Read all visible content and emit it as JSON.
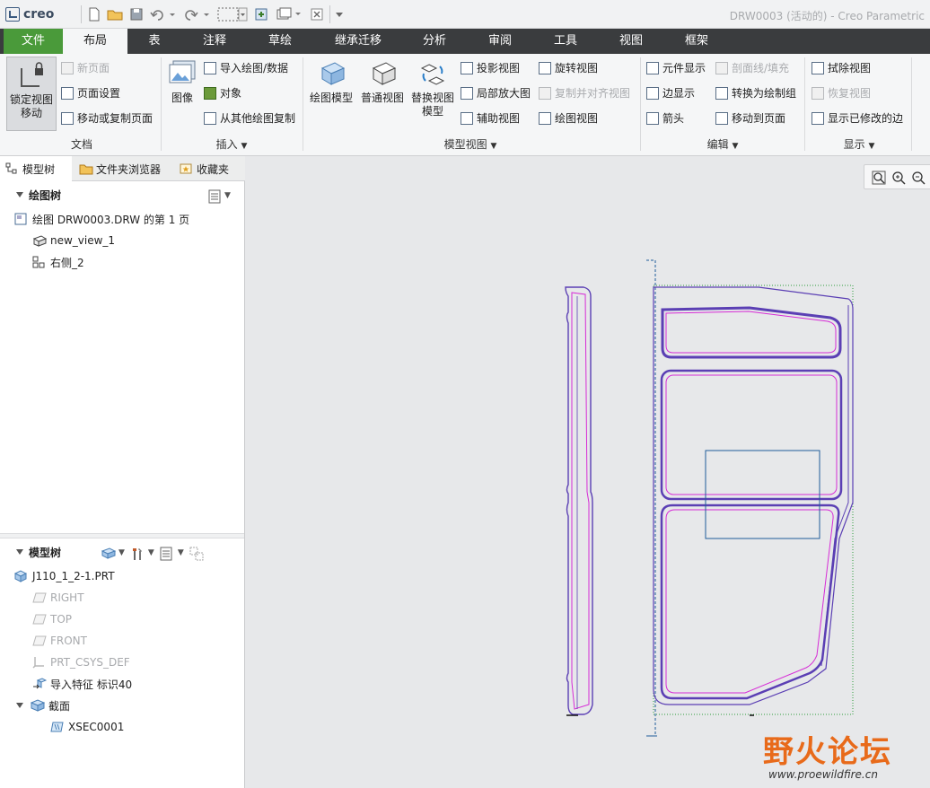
{
  "app": {
    "logo": "creo",
    "window_title": "DRW0003 (活动的) - Creo Parametric"
  },
  "menu_tabs": [
    "文件",
    "布局",
    "表",
    "注释",
    "草绘",
    "继承迁移",
    "分析",
    "审阅",
    "工具",
    "视图",
    "框架"
  ],
  "active_tab": "布局",
  "ribbon": {
    "doc_group": {
      "label": "文档",
      "lock_view_line1": "锁定视图",
      "lock_view_line2": "移动",
      "new_page": "新页面",
      "page_setup": "页面设置",
      "move_copy_page": "移动或复制页面"
    },
    "insert_group": {
      "label": "插入",
      "image": "图像",
      "import_drawing": "导入绘图/数据",
      "object": "对象",
      "copy_from_other": "从其他绘图复制"
    },
    "model_views_group": {
      "label": "模型视图",
      "drawing_model": "绘图模型",
      "general_view": "普通视图",
      "replace_view_line1": "替换视图",
      "replace_view_line2": "模型",
      "projection_view": "投影视图",
      "detailed_view": "局部放大图",
      "auxiliary_view": "辅助视图",
      "revolved_view": "旋转视图",
      "copy_align_view": "复制并对齐视图",
      "drawing_view": "绘图视图"
    },
    "edit_group": {
      "label": "编辑",
      "component_display": "元件显示",
      "section_fill": "剖面线/填充",
      "edge_display": "边显示",
      "convert_to_group": "转换为绘制组",
      "arrows": "箭头",
      "move_to_page": "移动到页面"
    },
    "display_group": {
      "label": "显示",
      "erase_view": "拭除视图",
      "resume_view": "恢复视图",
      "show_modified_edges": "显示已修改的边"
    }
  },
  "left_panel": {
    "tabs": [
      "模型树",
      "文件夹浏览器",
      "收藏夹"
    ],
    "drawing_tree": {
      "header": "绘图树",
      "items": [
        "绘图 DRW0003.DRW 的第 1 页",
        "new_view_1",
        "右侧_2"
      ]
    },
    "model_tree": {
      "header": "模型树",
      "items": [
        "J110_1_2-1.PRT",
        "RIGHT",
        "TOP",
        "FRONT",
        "PRT_CSYS_DEF",
        "导入特征 标识40",
        "截面",
        "XSEC0001"
      ]
    }
  },
  "colors": {
    "file_tab": "#4a9a3a",
    "tab_bar": "#3a3c3e",
    "view_outline": "#5b3fb4",
    "view_magenta": "#d62bd6",
    "selection_box": "#1f5c99",
    "bounding_dots": "#2e9c3a"
  },
  "watermark": {
    "text": "野火论坛",
    "url": "www.proewildfire.cn"
  }
}
